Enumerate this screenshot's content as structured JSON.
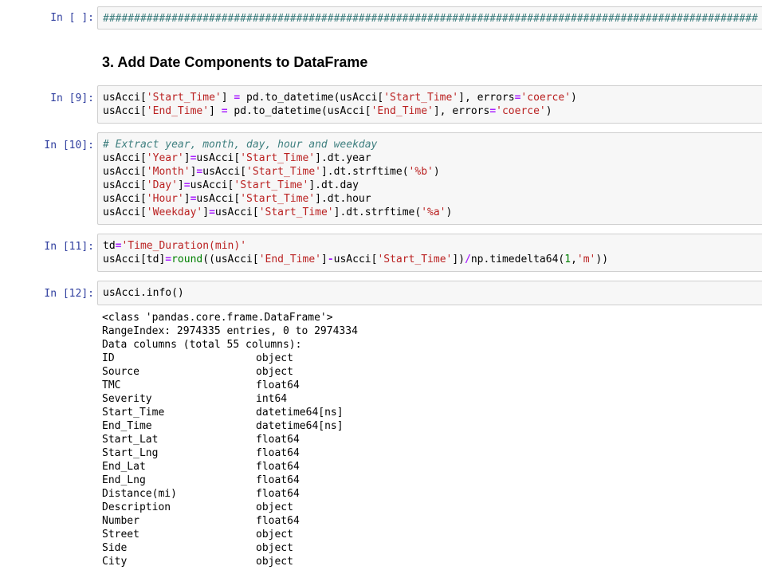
{
  "cells": [
    {
      "prompt": "In [ ]:",
      "hash_line": "##########################################################################################################"
    },
    {
      "heading": "3. Add Date Components to DataFrame"
    },
    {
      "prompt": "In [9]:",
      "lines": [
        [
          {
            "t": "usAcci[",
            "c": ""
          },
          {
            "t": "'Start_Time'",
            "c": "str"
          },
          {
            "t": "] ",
            "c": ""
          },
          {
            "t": "=",
            "c": "op"
          },
          {
            "t": " pd.to_datetime(usAcci[",
            "c": ""
          },
          {
            "t": "'Start_Time'",
            "c": "str"
          },
          {
            "t": "], errors",
            "c": ""
          },
          {
            "t": "=",
            "c": "op"
          },
          {
            "t": "'coerce'",
            "c": "str"
          },
          {
            "t": ")",
            "c": ""
          }
        ],
        [
          {
            "t": "usAcci[",
            "c": ""
          },
          {
            "t": "'End_Time'",
            "c": "str"
          },
          {
            "t": "] ",
            "c": ""
          },
          {
            "t": "=",
            "c": "op"
          },
          {
            "t": " pd.to_datetime(usAcci[",
            "c": ""
          },
          {
            "t": "'End_Time'",
            "c": "str"
          },
          {
            "t": "], errors",
            "c": ""
          },
          {
            "t": "=",
            "c": "op"
          },
          {
            "t": "'coerce'",
            "c": "str"
          },
          {
            "t": ")",
            "c": ""
          }
        ]
      ]
    },
    {
      "prompt": "In [10]:",
      "lines": [
        [
          {
            "t": "# Extract year, month, day, hour and weekday",
            "c": "com"
          }
        ],
        [
          {
            "t": "usAcci[",
            "c": ""
          },
          {
            "t": "'Year'",
            "c": "str"
          },
          {
            "t": "]",
            "c": ""
          },
          {
            "t": "=",
            "c": "op"
          },
          {
            "t": "usAcci[",
            "c": ""
          },
          {
            "t": "'Start_Time'",
            "c": "str"
          },
          {
            "t": "].dt.year",
            "c": ""
          }
        ],
        [
          {
            "t": "usAcci[",
            "c": ""
          },
          {
            "t": "'Month'",
            "c": "str"
          },
          {
            "t": "]",
            "c": ""
          },
          {
            "t": "=",
            "c": "op"
          },
          {
            "t": "usAcci[",
            "c": ""
          },
          {
            "t": "'Start_Time'",
            "c": "str"
          },
          {
            "t": "].dt.strftime(",
            "c": ""
          },
          {
            "t": "'%b'",
            "c": "str"
          },
          {
            "t": ")",
            "c": ""
          }
        ],
        [
          {
            "t": "usAcci[",
            "c": ""
          },
          {
            "t": "'Day'",
            "c": "str"
          },
          {
            "t": "]",
            "c": ""
          },
          {
            "t": "=",
            "c": "op"
          },
          {
            "t": "usAcci[",
            "c": ""
          },
          {
            "t": "'Start_Time'",
            "c": "str"
          },
          {
            "t": "].dt.day",
            "c": ""
          }
        ],
        [
          {
            "t": "usAcci[",
            "c": ""
          },
          {
            "t": "'Hour'",
            "c": "str"
          },
          {
            "t": "]",
            "c": ""
          },
          {
            "t": "=",
            "c": "op"
          },
          {
            "t": "usAcci[",
            "c": ""
          },
          {
            "t": "'Start_Time'",
            "c": "str"
          },
          {
            "t": "].dt.hour",
            "c": ""
          }
        ],
        [
          {
            "t": "usAcci[",
            "c": ""
          },
          {
            "t": "'Weekday'",
            "c": "str"
          },
          {
            "t": "]",
            "c": ""
          },
          {
            "t": "=",
            "c": "op"
          },
          {
            "t": "usAcci[",
            "c": ""
          },
          {
            "t": "'Start_Time'",
            "c": "str"
          },
          {
            "t": "].dt.strftime(",
            "c": ""
          },
          {
            "t": "'%a'",
            "c": "str"
          },
          {
            "t": ")",
            "c": ""
          }
        ]
      ]
    },
    {
      "prompt": "In [11]:",
      "lines": [
        [
          {
            "t": "td",
            "c": ""
          },
          {
            "t": "=",
            "c": "op"
          },
          {
            "t": "'Time_Duration(min)'",
            "c": "str"
          }
        ],
        [
          {
            "t": "usAcci[td]",
            "c": ""
          },
          {
            "t": "=",
            "c": "op"
          },
          {
            "t": "round",
            "c": "bi"
          },
          {
            "t": "((usAcci[",
            "c": ""
          },
          {
            "t": "'End_Time'",
            "c": "str"
          },
          {
            "t": "]",
            "c": ""
          },
          {
            "t": "-",
            "c": "op"
          },
          {
            "t": "usAcci[",
            "c": ""
          },
          {
            "t": "'Start_Time'",
            "c": "str"
          },
          {
            "t": "])",
            "c": ""
          },
          {
            "t": "/",
            "c": "op"
          },
          {
            "t": "np.timedelta64(",
            "c": ""
          },
          {
            "t": "1",
            "c": "num"
          },
          {
            "t": ",",
            "c": ""
          },
          {
            "t": "'m'",
            "c": "str"
          },
          {
            "t": "))",
            "c": ""
          }
        ]
      ]
    },
    {
      "prompt": "In [12]:",
      "lines": [
        [
          {
            "t": "usAcci.info()",
            "c": ""
          }
        ]
      ]
    }
  ],
  "output": {
    "header": [
      "<class 'pandas.core.frame.DataFrame'>",
      "RangeIndex: 2974335 entries, 0 to 2974334",
      "Data columns (total 55 columns):"
    ],
    "columns": [
      [
        "ID",
        "object"
      ],
      [
        "Source",
        "object"
      ],
      [
        "TMC",
        "float64"
      ],
      [
        "Severity",
        "int64"
      ],
      [
        "Start_Time",
        "datetime64[ns]"
      ],
      [
        "End_Time",
        "datetime64[ns]"
      ],
      [
        "Start_Lat",
        "float64"
      ],
      [
        "Start_Lng",
        "float64"
      ],
      [
        "End_Lat",
        "float64"
      ],
      [
        "End_Lng",
        "float64"
      ],
      [
        "Distance(mi)",
        "float64"
      ],
      [
        "Description",
        "object"
      ],
      [
        "Number",
        "float64"
      ],
      [
        "Street",
        "object"
      ],
      [
        "Side",
        "object"
      ],
      [
        "City",
        "object"
      ]
    ]
  }
}
